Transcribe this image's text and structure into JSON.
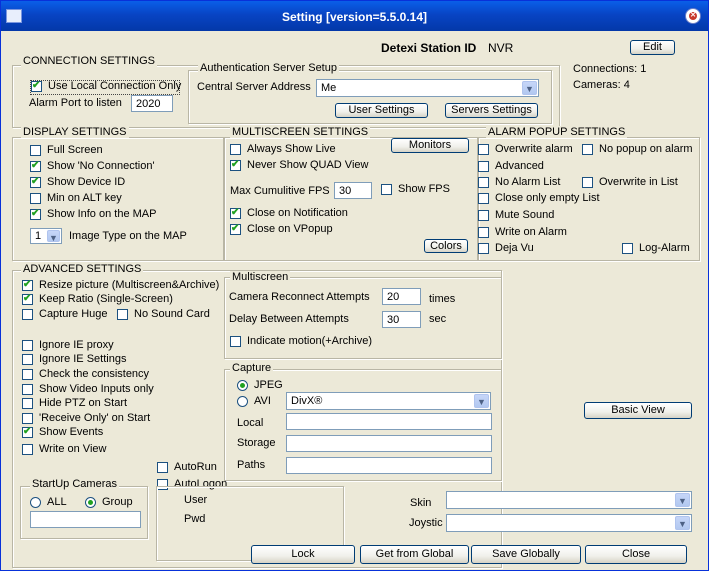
{
  "window": {
    "title": "Setting [version=5.5.0.14]"
  },
  "header": {
    "station_label": "Detexi Station ID",
    "station_value": "NVR",
    "edit": "Edit"
  },
  "status": {
    "connections": "Connections: 1",
    "cameras": "Cameras: 4"
  },
  "connection": {
    "title": "CONNECTION SETTINGS",
    "use_local": "Use Local Connection Only",
    "alarm_port_label": "Alarm Port to listen",
    "alarm_port_value": "2020"
  },
  "auth": {
    "title": "Authentication Server Setup",
    "central_label": "Central Server Address",
    "central_value": "Me",
    "user_settings": "User Settings",
    "servers_settings": "Servers Settings"
  },
  "display": {
    "title": "DISPLAY SETTINGS",
    "full_screen": "Full Screen",
    "show_no_conn": "Show 'No Connection'",
    "show_device_id": "Show Device ID",
    "min_alt": "Min on ALT key",
    "show_info_map": "Show Info on the MAP",
    "image_type_value": "1",
    "image_type_label": "Image Type on the MAP"
  },
  "multiscreen": {
    "title": "MULTISCREEN SETTINGS",
    "always_live": "Always Show Live",
    "never_quad": "Never Show QUAD View",
    "monitors": "Monitors",
    "max_fps_label": "Max  Cumulitive FPS",
    "max_fps_value": "30",
    "show_fps": "Show FPS",
    "close_notification": "Close on Notification",
    "close_vpopup": "Close on VPopup",
    "colors": "Colors"
  },
  "alarm_popup": {
    "title": "ALARM POPUP SETTINGS",
    "overwrite_alarm": "Overwrite alarm",
    "no_popup": "No popup on alarm",
    "advanced": "Advanced",
    "no_alarm_list": "No  Alarm List",
    "overwrite_list": "Overwrite in List",
    "close_empty": "Close only empty List",
    "mute": "Mute Sound",
    "write_alarm": "Write on Alarm",
    "deja_vu": "Deja Vu",
    "log_alarm": "Log-Alarm"
  },
  "advanced": {
    "title": "ADVANCED SETTINGS",
    "resize": "Resize picture (Multiscreen&Archive)",
    "keep_ratio": "Keep Ratio (Single-Screen)",
    "capture_huge": "Capture Huge",
    "no_sound": "No Sound Card",
    "ignore_proxy": "Ignore IE proxy",
    "ignore_settings": "Ignore IE Settings",
    "check_consistency": "Check the consistency",
    "show_video_inputs": "Show Video Inputs  only",
    "hide_ptz": "Hide PTZ on Start",
    "receive_only": "'Receive Only' on Start",
    "show_events": "Show Events",
    "write_view": "Write on View"
  },
  "multiscreen2": {
    "title": "Multiscreen",
    "reconnect_label": "Camera Reconnect Attempts",
    "reconnect_value": "20",
    "reconnect_unit": "times",
    "delay_label": "Delay Between Attempts",
    "delay_value": "30",
    "delay_unit": "sec",
    "indicate_motion": "Indicate motion(+Archive)"
  },
  "capture": {
    "title": "Capture",
    "jpeg": "JPEG",
    "avi": "AVI",
    "codec": "DivX®",
    "local": "Local",
    "storage": "Storage",
    "paths": "Paths"
  },
  "basic_view": "Basic View",
  "autorun": "AutoRun",
  "autologon": {
    "label": "AutoLogon",
    "user": "User",
    "pwd": "Pwd"
  },
  "startup": {
    "title": "StartUp Cameras",
    "all": "ALL",
    "group": "Group"
  },
  "skin_label": "Skin",
  "joystic_label": "Joystic",
  "footer": {
    "lock": "Lock",
    "get_global": "Get from Global",
    "save_global": "Save Globally",
    "close": "Close"
  }
}
